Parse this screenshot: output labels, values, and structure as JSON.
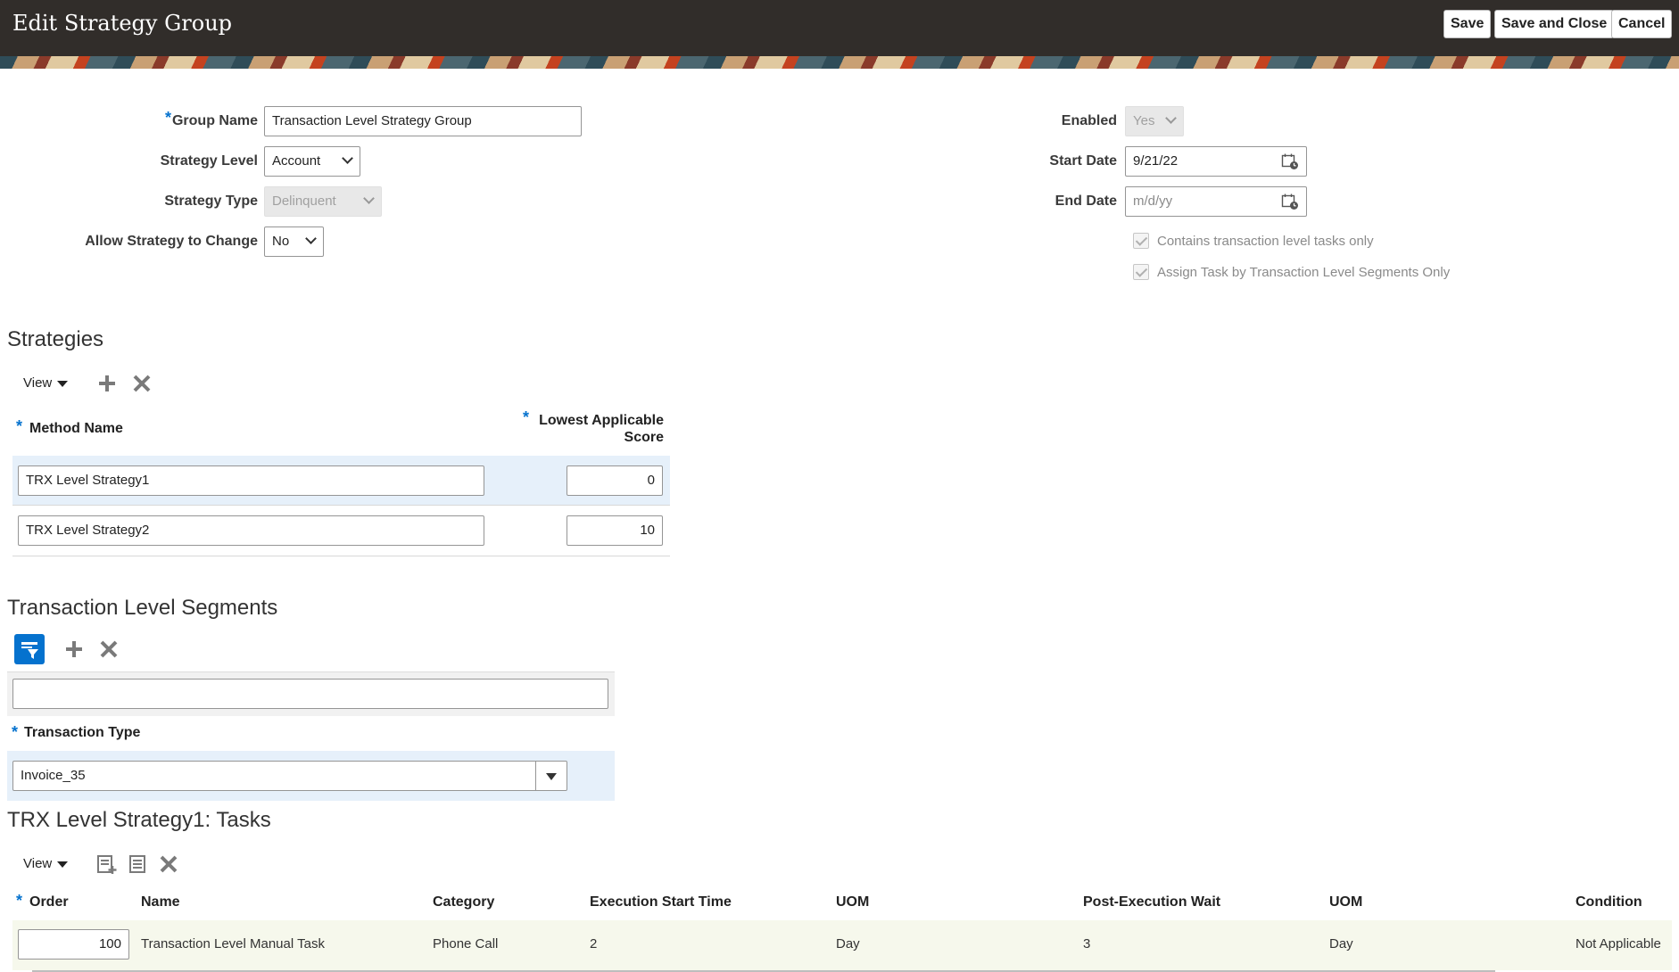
{
  "header": {
    "title": "Edit Strategy Group",
    "save_label": "Save",
    "save_close_label": "Save and Close",
    "cancel_label": "Cancel"
  },
  "form": {
    "group_name_label": "Group Name",
    "group_name_value": "Transaction Level Strategy Group",
    "strategy_level_label": "Strategy Level",
    "strategy_level_value": "Account",
    "strategy_type_label": "Strategy Type",
    "strategy_type_value": "Delinquent",
    "allow_change_label": "Allow Strategy to Change",
    "allow_change_value": "No",
    "enabled_label": "Enabled",
    "enabled_value": "Yes",
    "start_date_label": "Start Date",
    "start_date_value": "9/21/22",
    "end_date_label": "End Date",
    "end_date_placeholder": "m/d/yy",
    "contains_trx_label": "Contains transaction level tasks only",
    "assign_task_label": "Assign Task by Transaction Level Segments Only"
  },
  "strategies": {
    "title": "Strategies",
    "view_label": "View",
    "col_method": "Method Name",
    "col_score_1": "Lowest Applicable",
    "col_score_2": "Score",
    "rows": [
      {
        "method": "TRX Level Strategy1",
        "score": "0"
      },
      {
        "method": "TRX Level Strategy2",
        "score": "10"
      }
    ]
  },
  "segments": {
    "title": "Transaction Level Segments",
    "col_type": "Transaction Type",
    "type_value": "Invoice_35"
  },
  "tasks": {
    "title": "TRX Level Strategy1: Tasks",
    "view_label": "View",
    "columns": [
      "Order",
      "Name",
      "Category",
      "Execution Start Time",
      "UOM",
      "Post-Execution Wait",
      "UOM",
      "Condition"
    ],
    "rows": [
      {
        "order": "100",
        "name": "Transaction Level Manual Task",
        "category": "Phone Call",
        "start": "2",
        "uom1": "Day",
        "wait": "3",
        "uom2": "Day",
        "condition": "Not Applicable"
      }
    ]
  },
  "colors": {
    "header_bg": "#312d2a",
    "accent": "#0572ce",
    "row_highlight": "#e6f0fa"
  }
}
